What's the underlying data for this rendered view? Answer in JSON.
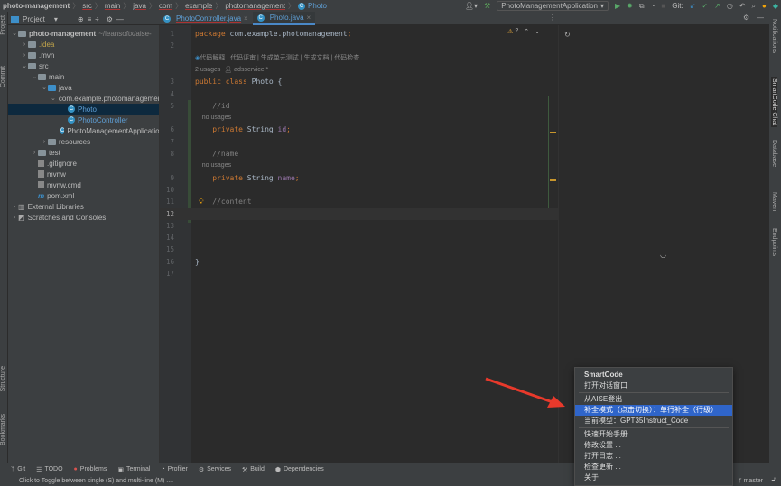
{
  "breadcrumb": [
    "photo-management",
    "src",
    "main",
    "java",
    "com",
    "example",
    "photomanagement",
    "Photo"
  ],
  "toolbar": {
    "run_config": "PhotoManagementApplication",
    "git_label": "Git:"
  },
  "project_panel": {
    "title": "Project",
    "tree": [
      {
        "label": "photo-management",
        "extra": "~/leansoftx/aise-",
        "depth": 0,
        "arrow": "v",
        "icon": "folder"
      },
      {
        "label": ".idea",
        "depth": 1,
        "arrow": ">",
        "icon": "folder",
        "color": "#c5a74b"
      },
      {
        "label": ".mvn",
        "depth": 1,
        "arrow": ">",
        "icon": "folder"
      },
      {
        "label": "src",
        "depth": 1,
        "arrow": "v",
        "icon": "folder"
      },
      {
        "label": "main",
        "depth": 2,
        "arrow": "v",
        "icon": "folder"
      },
      {
        "label": "java",
        "depth": 3,
        "arrow": "v",
        "icon": "folder-blue"
      },
      {
        "label": "com.example.photomanagement",
        "depth": 4,
        "arrow": "v",
        "icon": "package"
      },
      {
        "label": "Photo",
        "depth": 5,
        "icon": "class",
        "selected": true,
        "color": "#5e9fd6"
      },
      {
        "label": "PhotoController",
        "depth": 5,
        "icon": "class",
        "color": "#5e9fd6"
      },
      {
        "label": "PhotoManagementApplication",
        "depth": 5,
        "icon": "class"
      },
      {
        "label": "resources",
        "depth": 3,
        "arrow": ">",
        "icon": "folder"
      },
      {
        "label": "test",
        "depth": 2,
        "arrow": ">",
        "icon": "folder"
      },
      {
        "label": ".gitignore",
        "depth": 2,
        "icon": "file"
      },
      {
        "label": "mvnw",
        "depth": 2,
        "icon": "file"
      },
      {
        "label": "mvnw.cmd",
        "depth": 2,
        "icon": "file"
      },
      {
        "label": "pom.xml",
        "depth": 2,
        "icon": "maven"
      },
      {
        "label": "External Libraries",
        "depth": 0,
        "arrow": ">",
        "icon": "library"
      },
      {
        "label": "Scratches and Consoles",
        "depth": 0,
        "arrow": ">",
        "icon": "scratch"
      }
    ]
  },
  "tabs": [
    {
      "label": "PhotoController.java",
      "active": false
    },
    {
      "label": "Photo.java",
      "active": true
    }
  ],
  "editor": {
    "warnings": "2",
    "code_lens": "代码解释 | 代码评审 | 生成单元测试 | 生成文档 | 代码检查",
    "usages": "2 usages",
    "author": "adsservice *",
    "rows": [
      {
        "n": "1",
        "t": "code",
        "parts": [
          [
            "kw",
            "package "
          ],
          [
            "id",
            "com.example.photomanagement"
          ],
          [
            "kw",
            ";"
          ]
        ]
      },
      {
        "n": "2",
        "t": "code",
        "parts": []
      },
      {
        "n": "",
        "t": "lens"
      },
      {
        "n": "",
        "t": "usages"
      },
      {
        "n": "3",
        "t": "code",
        "parts": [
          [
            "kw",
            "public class "
          ],
          [
            "id",
            "Photo {"
          ]
        ]
      },
      {
        "n": "4",
        "t": "code",
        "parts": []
      },
      {
        "n": "5",
        "t": "code",
        "parts": [
          [
            "cm",
            "    //id"
          ]
        ]
      },
      {
        "n": "",
        "t": "hint",
        "text": "    no usages"
      },
      {
        "n": "6",
        "t": "code",
        "parts": [
          [
            "kw",
            "    private "
          ],
          [
            "id",
            "String "
          ],
          [
            "fld",
            "id"
          ],
          [
            "kw",
            ";"
          ]
        ]
      },
      {
        "n": "7",
        "t": "code",
        "parts": []
      },
      {
        "n": "8",
        "t": "code",
        "parts": [
          [
            "cm",
            "    //name"
          ]
        ]
      },
      {
        "n": "",
        "t": "hint",
        "text": "    no usages"
      },
      {
        "n": "9",
        "t": "code",
        "parts": [
          [
            "kw",
            "    private "
          ],
          [
            "id",
            "String "
          ],
          [
            "fld",
            "name"
          ],
          [
            "kw",
            ";"
          ]
        ]
      },
      {
        "n": "10",
        "t": "code",
        "parts": []
      },
      {
        "n": "11",
        "t": "code",
        "parts": [
          [
            "cm",
            "    //content"
          ]
        ],
        "bulb": true
      },
      {
        "n": "12",
        "t": "code",
        "parts": [],
        "current": true
      },
      {
        "n": "13",
        "t": "code",
        "parts": []
      },
      {
        "n": "14",
        "t": "code",
        "parts": []
      },
      {
        "n": "15",
        "t": "code",
        "parts": []
      },
      {
        "n": "16",
        "t": "code",
        "parts": [
          [
            "id",
            "}"
          ]
        ]
      },
      {
        "n": "17",
        "t": "code",
        "parts": []
      }
    ]
  },
  "right_strip": [
    "Notifications",
    "SmartCode Chat",
    "Database",
    "Maven",
    "Endpoints"
  ],
  "left_strip": {
    "top": [
      "Project",
      "Commit"
    ],
    "bottom": [
      "Structure",
      "Bookmarks"
    ]
  },
  "bottom_tools": [
    "Git",
    "TODO",
    "Problems",
    "Terminal",
    "Profiler",
    "Services",
    "Build",
    "Dependencies"
  ],
  "status": {
    "message": "Click to Toggle between single (S) and multi-line (M) ....",
    "branch": "master"
  },
  "popup_menu": {
    "groups": [
      [
        {
          "label": "SmartCode",
          "bold": true
        },
        {
          "label": "打开对话窗口"
        }
      ],
      [
        {
          "label": "从AISE登出"
        },
        {
          "label": "补全模式（点击切换）：单行补全（行级）",
          "selected": true
        },
        {
          "label": "当前模型：GPT35Instruct_Code"
        }
      ],
      [
        {
          "label": "快速开始手册 ..."
        },
        {
          "label": "修改设置 ..."
        },
        {
          "label": "打开日志 ..."
        },
        {
          "label": "检查更新 ..."
        },
        {
          "label": "关于"
        }
      ]
    ]
  },
  "colors": {
    "accent": "#2f65ca",
    "annotation_arrow": "#e8392b"
  }
}
